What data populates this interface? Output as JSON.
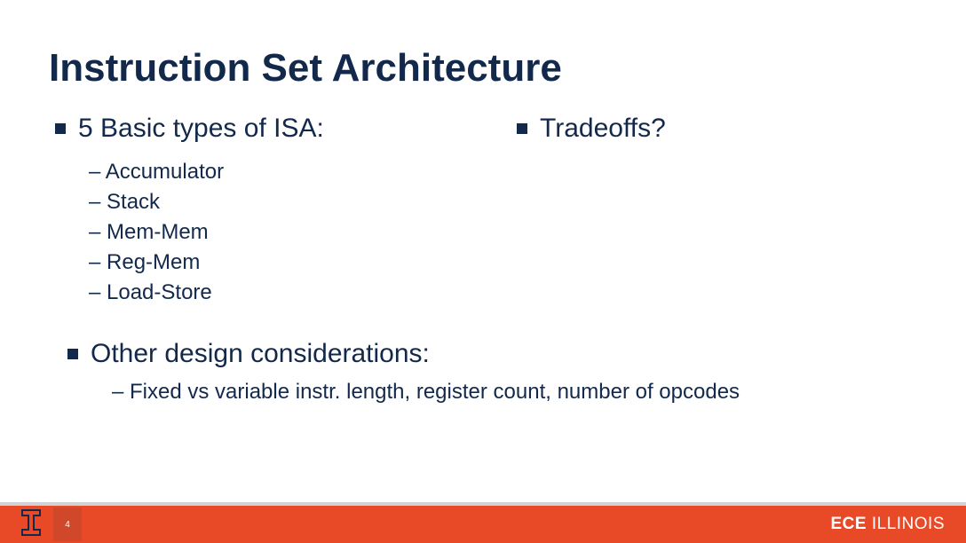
{
  "slide": {
    "title": "Instruction Set Architecture",
    "left_heading": "5 Basic types of ISA:",
    "right_heading": "Tradeoffs?",
    "isa_types": [
      "– Accumulator",
      "– Stack",
      "– Mem-Mem",
      "– Reg-Mem",
      "– Load-Store"
    ],
    "other_heading": "Other design considerations:",
    "other_items": [
      "– Fixed vs variable instr. length, register count, number of opcodes"
    ]
  },
  "footer": {
    "page_number": "4",
    "dept_bold": "ECE",
    "dept_light": " ILLINOIS"
  },
  "colors": {
    "brand_navy": "#13294b",
    "brand_orange": "#e84a27"
  }
}
